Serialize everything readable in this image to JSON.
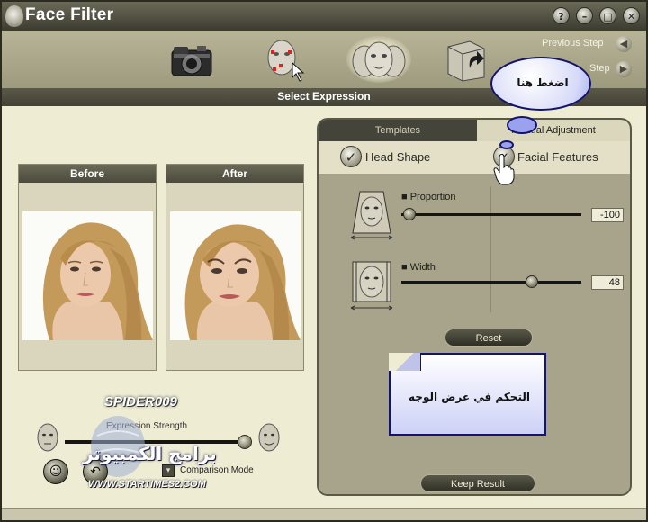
{
  "window": {
    "title": "Face Filter",
    "buttons": [
      "?",
      "–",
      "□",
      "✕"
    ]
  },
  "toolbar": {
    "icons": [
      "camera-icon",
      "face-markers-icon",
      "expression-faces-icon",
      "save-export-icon"
    ],
    "previous_step": "Previous Step",
    "next_step": "Step",
    "section_title": "Select Expression"
  },
  "before_panel": {
    "title": "Before"
  },
  "after_panel": {
    "title": "After"
  },
  "right_panel": {
    "tabs": {
      "templates": "Templates",
      "manual": "Manual Adjustment"
    },
    "options": {
      "head_shape": "Head Shape",
      "facial_features": "Facial Features"
    },
    "proportion": {
      "label": "Proportion",
      "value": "-100",
      "level": -100
    },
    "width": {
      "label": "Width",
      "value": "48",
      "level": 48
    },
    "reset_label": "Reset",
    "keep_result_label": "Keep Result"
  },
  "callouts": {
    "bubble_text": "اضغط هنا",
    "note_text": "التحكم في عرض الوجه"
  },
  "bottom": {
    "watermark_name": "SPIDER009",
    "watermark_arabic": "برامج الكمبيوتر",
    "watermark_url": "WWW.STARTIMES2.COM",
    "expression_strength": "Expression Strength",
    "comparison_mode": "Comparison Mode"
  },
  "colors": {
    "panel_bg": "#a6a38a",
    "dark_bar": "#45443a",
    "window_bg": "#efecd4",
    "callout_border": "#14146b"
  }
}
